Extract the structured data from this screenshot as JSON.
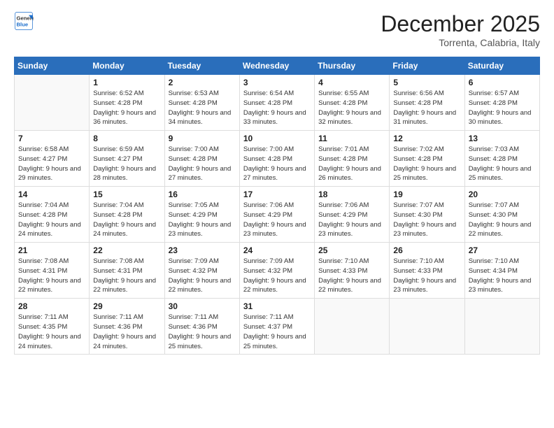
{
  "header": {
    "logo_line1": "General",
    "logo_line2": "Blue",
    "month": "December 2025",
    "location": "Torrenta, Calabria, Italy"
  },
  "days_of_week": [
    "Sunday",
    "Monday",
    "Tuesday",
    "Wednesday",
    "Thursday",
    "Friday",
    "Saturday"
  ],
  "weeks": [
    [
      {
        "day": "",
        "empty": true
      },
      {
        "day": "1",
        "sunrise": "6:52 AM",
        "sunset": "4:28 PM",
        "daylight": "9 hours and 36 minutes."
      },
      {
        "day": "2",
        "sunrise": "6:53 AM",
        "sunset": "4:28 PM",
        "daylight": "9 hours and 34 minutes."
      },
      {
        "day": "3",
        "sunrise": "6:54 AM",
        "sunset": "4:28 PM",
        "daylight": "9 hours and 33 minutes."
      },
      {
        "day": "4",
        "sunrise": "6:55 AM",
        "sunset": "4:28 PM",
        "daylight": "9 hours and 32 minutes."
      },
      {
        "day": "5",
        "sunrise": "6:56 AM",
        "sunset": "4:28 PM",
        "daylight": "9 hours and 31 minutes."
      },
      {
        "day": "6",
        "sunrise": "6:57 AM",
        "sunset": "4:28 PM",
        "daylight": "9 hours and 30 minutes."
      }
    ],
    [
      {
        "day": "7",
        "sunrise": "6:58 AM",
        "sunset": "4:27 PM",
        "daylight": "9 hours and 29 minutes."
      },
      {
        "day": "8",
        "sunrise": "6:59 AM",
        "sunset": "4:27 PM",
        "daylight": "9 hours and 28 minutes."
      },
      {
        "day": "9",
        "sunrise": "7:00 AM",
        "sunset": "4:28 PM",
        "daylight": "9 hours and 27 minutes."
      },
      {
        "day": "10",
        "sunrise": "7:00 AM",
        "sunset": "4:28 PM",
        "daylight": "9 hours and 27 minutes."
      },
      {
        "day": "11",
        "sunrise": "7:01 AM",
        "sunset": "4:28 PM",
        "daylight": "9 hours and 26 minutes."
      },
      {
        "day": "12",
        "sunrise": "7:02 AM",
        "sunset": "4:28 PM",
        "daylight": "9 hours and 25 minutes."
      },
      {
        "day": "13",
        "sunrise": "7:03 AM",
        "sunset": "4:28 PM",
        "daylight": "9 hours and 25 minutes."
      }
    ],
    [
      {
        "day": "14",
        "sunrise": "7:04 AM",
        "sunset": "4:28 PM",
        "daylight": "9 hours and 24 minutes."
      },
      {
        "day": "15",
        "sunrise": "7:04 AM",
        "sunset": "4:28 PM",
        "daylight": "9 hours and 24 minutes."
      },
      {
        "day": "16",
        "sunrise": "7:05 AM",
        "sunset": "4:29 PM",
        "daylight": "9 hours and 23 minutes."
      },
      {
        "day": "17",
        "sunrise": "7:06 AM",
        "sunset": "4:29 PM",
        "daylight": "9 hours and 23 minutes."
      },
      {
        "day": "18",
        "sunrise": "7:06 AM",
        "sunset": "4:29 PM",
        "daylight": "9 hours and 23 minutes."
      },
      {
        "day": "19",
        "sunrise": "7:07 AM",
        "sunset": "4:30 PM",
        "daylight": "9 hours and 23 minutes."
      },
      {
        "day": "20",
        "sunrise": "7:07 AM",
        "sunset": "4:30 PM",
        "daylight": "9 hours and 22 minutes."
      }
    ],
    [
      {
        "day": "21",
        "sunrise": "7:08 AM",
        "sunset": "4:31 PM",
        "daylight": "9 hours and 22 minutes."
      },
      {
        "day": "22",
        "sunrise": "7:08 AM",
        "sunset": "4:31 PM",
        "daylight": "9 hours and 22 minutes."
      },
      {
        "day": "23",
        "sunrise": "7:09 AM",
        "sunset": "4:32 PM",
        "daylight": "9 hours and 22 minutes."
      },
      {
        "day": "24",
        "sunrise": "7:09 AM",
        "sunset": "4:32 PM",
        "daylight": "9 hours and 22 minutes."
      },
      {
        "day": "25",
        "sunrise": "7:10 AM",
        "sunset": "4:33 PM",
        "daylight": "9 hours and 22 minutes."
      },
      {
        "day": "26",
        "sunrise": "7:10 AM",
        "sunset": "4:33 PM",
        "daylight": "9 hours and 23 minutes."
      },
      {
        "day": "27",
        "sunrise": "7:10 AM",
        "sunset": "4:34 PM",
        "daylight": "9 hours and 23 minutes."
      }
    ],
    [
      {
        "day": "28",
        "sunrise": "7:11 AM",
        "sunset": "4:35 PM",
        "daylight": "9 hours and 24 minutes."
      },
      {
        "day": "29",
        "sunrise": "7:11 AM",
        "sunset": "4:36 PM",
        "daylight": "9 hours and 24 minutes."
      },
      {
        "day": "30",
        "sunrise": "7:11 AM",
        "sunset": "4:36 PM",
        "daylight": "9 hours and 25 minutes."
      },
      {
        "day": "31",
        "sunrise": "7:11 AM",
        "sunset": "4:37 PM",
        "daylight": "9 hours and 25 minutes."
      },
      {
        "day": "",
        "empty": true
      },
      {
        "day": "",
        "empty": true
      },
      {
        "day": "",
        "empty": true
      }
    ]
  ],
  "labels": {
    "sunrise": "Sunrise:",
    "sunset": "Sunset:",
    "daylight": "Daylight:"
  }
}
